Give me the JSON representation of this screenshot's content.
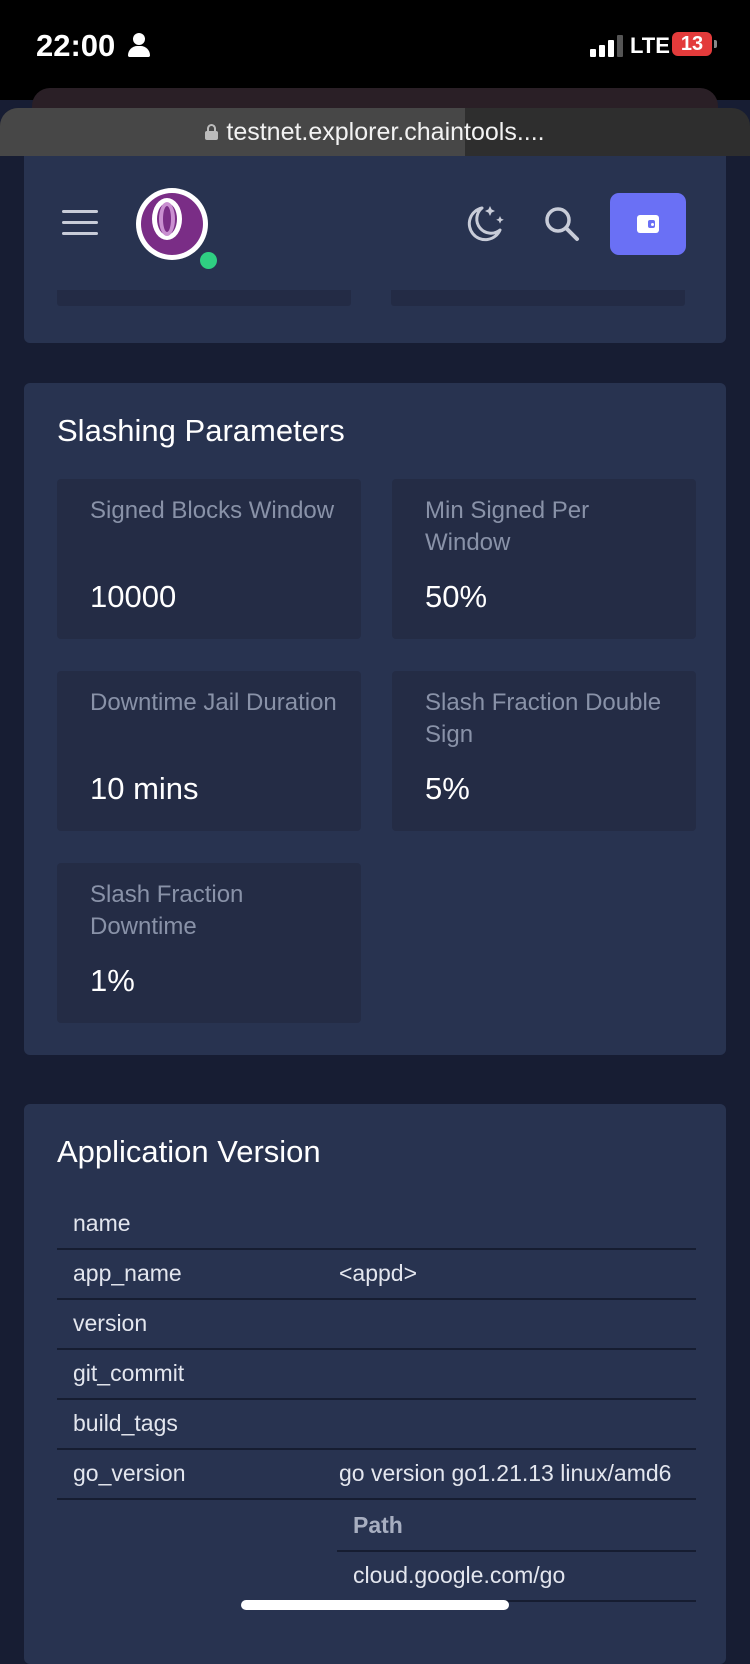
{
  "status_bar": {
    "time": "22:00",
    "network": "LTE",
    "battery": "13"
  },
  "browser": {
    "url": "testnet.explorer.chaintools....",
    "load_progress_percent": 62
  },
  "header": {
    "menu_icon": "hamburger-icon",
    "logo_icon": "chain-logo-icon",
    "status_dot_color": "#2fcf82",
    "theme_icon": "moon-stars-icon",
    "search_icon": "search-icon",
    "wallet_icon": "wallet-icon",
    "accent": "#6a70f5"
  },
  "slashing": {
    "title": "Slashing Parameters",
    "params": [
      {
        "label": "Signed Blocks Window",
        "value": "10000"
      },
      {
        "label": "Min Signed Per Window",
        "value": "50%"
      },
      {
        "label": "Downtime Jail Duration",
        "value": "10 mins"
      },
      {
        "label": "Slash Fraction Double Sign",
        "value": "5%"
      },
      {
        "label": "Slash Fraction Downtime",
        "value": "1%"
      }
    ]
  },
  "app_version": {
    "title": "Application Version",
    "rows": [
      {
        "key": "name",
        "value": ""
      },
      {
        "key": "app_name",
        "value": "<appd>"
      },
      {
        "key": "version",
        "value": ""
      },
      {
        "key": "git_commit",
        "value": ""
      },
      {
        "key": "build_tags",
        "value": ""
      },
      {
        "key": "go_version",
        "value": "go version go1.21.13 linux/amd6"
      }
    ],
    "deps": {
      "header": "Path",
      "rows": [
        "cloud.google.com/go"
      ]
    }
  }
}
